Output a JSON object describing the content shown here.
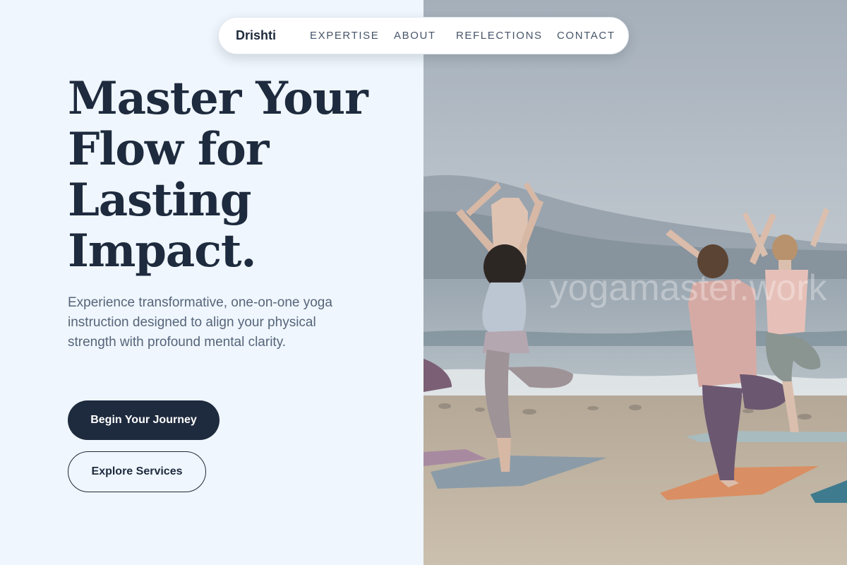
{
  "nav": {
    "brand": "Drishti",
    "links": [
      "EXPERTISE",
      "ABOUT",
      "REFLECTIONS",
      "CONTACT"
    ]
  },
  "hero": {
    "title_lines": [
      "Master Your",
      "Flow for",
      "Lasting",
      "Impact."
    ],
    "subtitle": "Experience transformative, one-on-one yoga instruction designed to align your physical strength with profound mental clarity.",
    "primary_cta": "Begin Your Journey",
    "secondary_cta": "Explore Services"
  },
  "image": {
    "subject": "yoga class on beach in tree pose",
    "watermark": "yogamaster.work"
  },
  "colors": {
    "background": "#eff6fd",
    "heading": "#1e2a3d",
    "body_text": "#56657a",
    "nav_text": "#475569",
    "primary_button": "#1e2a3d"
  }
}
